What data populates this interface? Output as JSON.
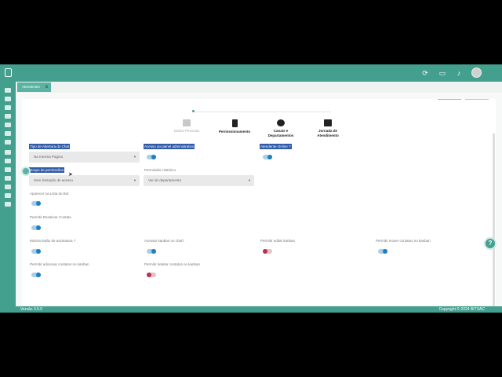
{
  "tabs": [
    {
      "label": "Atendentes",
      "close": "x"
    }
  ],
  "steps": [
    {
      "label": "Dados Pessoais",
      "icon": "id-card-icon",
      "state": "muted"
    },
    {
      "label": "Permissionamento",
      "icon": "chip-icon",
      "state": "active"
    },
    {
      "label": "Canais e Departamentos",
      "icon": "gears-icon",
      "state": "active"
    },
    {
      "label": "Jornada de Atendimento",
      "icon": "briefcase-clock-icon",
      "state": "active"
    }
  ],
  "form": {
    "tipo_abertura_label": "Tipo de Abertura do Chat",
    "tipo_abertura_value": "Na mesma Pagina",
    "acesso_painel_label": "Acesso ao painel administrativo",
    "atendente_online_label": "Atendente Online ?",
    "grupo_permissoes_label": "Grupo de permissões",
    "grupo_permissoes_value": "Sem limitação de acesso",
    "permissao_historico_label": "Permissão Histórico",
    "permissao_historico_value": "Ver do departamento",
    "aparecer_bot_label": "Aparecer na Lista do Bot",
    "desativar_contato_label": "Permitir Desativar Contato",
    "mostra_assinatura_label": "Mostra botão de assinatura ?",
    "acessar_kanban_label": "Acessar kanban no chat?",
    "editar_kanban_label": "Permitir editar kanban",
    "mover_contatos_label": "Permitir mover contatos no kanban",
    "adicionar_contatos_label": "Permitir adicionar contatos no kanban",
    "deletar_contatos_label": "Permitir deletar contatos no kanban"
  },
  "toggles": {
    "acesso_painel": "on",
    "atendente_online": "on",
    "aparecer_bot": "on",
    "desativar_contato": "on",
    "mostra_assinatura": "on",
    "acessar_kanban": "on",
    "editar_kanban": "off",
    "mover_contatos": "on",
    "adicionar_contatos": "on",
    "deletar_contatos": "off"
  },
  "footer": {
    "version": "Versão 3.5.0",
    "copyright": "Copyright © 2024 BITSAC"
  },
  "help": "?",
  "colors": {
    "brand": "#43a08f",
    "selection": "#2f5aa8",
    "toggle_on": "#1f7fbf",
    "toggle_off": "#b4344a"
  }
}
